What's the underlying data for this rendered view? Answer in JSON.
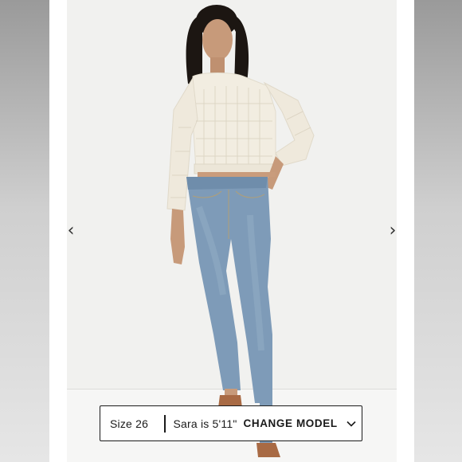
{
  "size_bar": {
    "size_label": "Size 26",
    "model_info": "Sara is 5'11\"",
    "change_model_label": "CHANGE MODEL"
  },
  "navigation": {
    "prev_icon": "chevron-left-icon",
    "next_icon": "chevron-right-icon",
    "prev_glyph": "‹",
    "next_glyph": "›"
  },
  "colors": {
    "backdrop": "#f1f1ef",
    "sweater": "#f2ede1",
    "denim": "#7e9bb8",
    "border": "#1a1a1a"
  }
}
